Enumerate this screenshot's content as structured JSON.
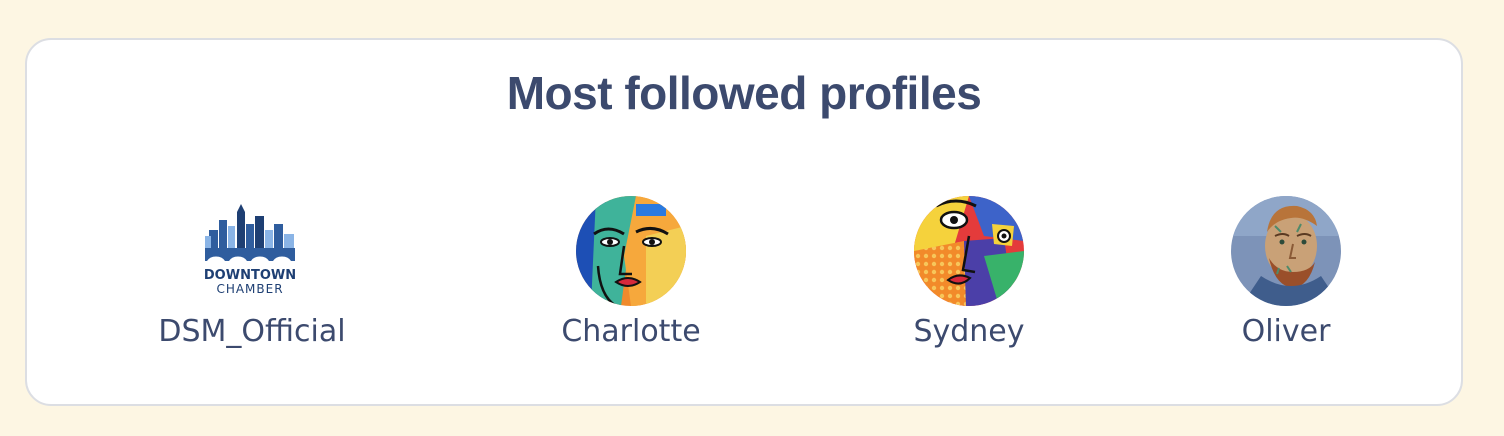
{
  "section": {
    "title": "Most followed profiles"
  },
  "profiles": [
    {
      "name": "DSM_Official",
      "avatar_icon": "downtown-chamber-logo",
      "logo_text_line1": "DOWNTOWN",
      "logo_text_line2": "CHAMBER"
    },
    {
      "name": "Charlotte",
      "avatar_icon": "abstract-face-avatar"
    },
    {
      "name": "Sydney",
      "avatar_icon": "abstract-face-avatar"
    },
    {
      "name": "Oliver",
      "avatar_icon": "portrait-painting-avatar"
    }
  ],
  "colors": {
    "page_background": "#fdf6e3",
    "card_background": "#ffffff",
    "text": "#3c4a6e",
    "logo_blue": "#2f5d9e",
    "logo_light_blue": "#8ab4e6"
  }
}
